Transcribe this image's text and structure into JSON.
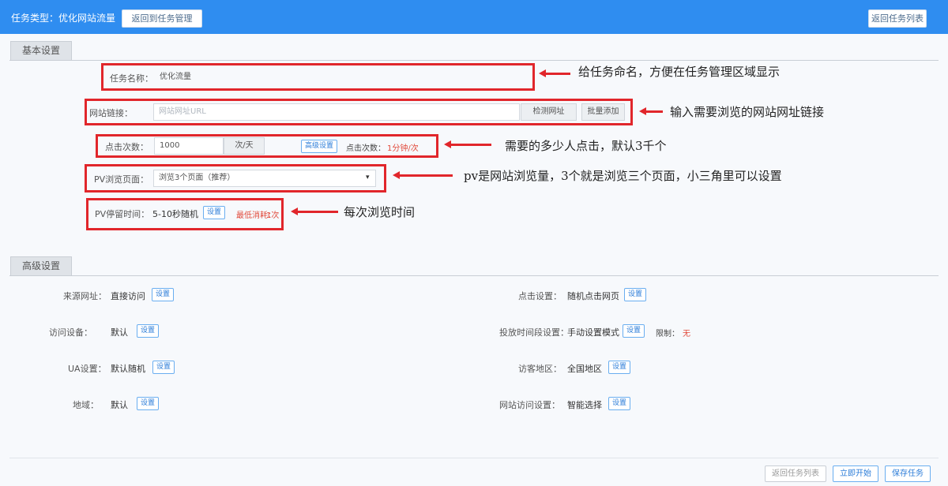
{
  "header": {
    "title": "任务类型：优化网站流量",
    "center_button": "返回到任务管理",
    "right_button": "返回任务列表"
  },
  "basic_section": {
    "title": "基本设置"
  },
  "form": {
    "task_name": {
      "label": "任务名称：",
      "value": "优化流量"
    },
    "url": {
      "label": "网站链接：",
      "placeholder": "网站网址URL",
      "button1": "检测网址",
      "button2": "批量添加"
    },
    "clicks": {
      "label": "点击次数：",
      "value": "1000",
      "unit": "次/天",
      "link_button": "高级设置",
      "extra_label": "点击次数：",
      "extra_value": "1分钟/次"
    },
    "pv": {
      "label": "PV浏览页面：",
      "value": "浏览3个页面（推荐）",
      "caret": "▾"
    },
    "pv_time": {
      "label": "PV停留时间：",
      "value": "5-10秒随机",
      "button": "设置",
      "red_text": "最低消耗：",
      "red_value": "1次"
    }
  },
  "annotations": {
    "n1": "给任务命名，方便在任务管理区域显示",
    "n2": "输入需要浏览的网站网址链接",
    "n3": "需要的多少人点击，默认3千个",
    "n4": "pv是网站浏览量，3个就是浏览三个页面，小三角里可以设置",
    "n5": "每次浏览时间"
  },
  "advanced_section": {
    "title": "高级设置"
  },
  "advanced": {
    "left": [
      {
        "label": "来源网址：",
        "value": "直接访问",
        "button": "设置"
      },
      {
        "label": "访问设备：",
        "value": "默认",
        "button": "设置"
      },
      {
        "label": "UA设置：",
        "value": "默认随机",
        "button": "设置"
      },
      {
        "label": "地域：",
        "value": "默认",
        "button": "设置"
      }
    ],
    "right": [
      {
        "label": "点击设置：",
        "value": "随机点击网页",
        "button": "设置"
      },
      {
        "label": "投放时间段设置：",
        "value": "手动设置模式",
        "button": "设置",
        "extra": "限制：",
        "extra_red": "无"
      },
      {
        "label": "访客地区：",
        "value": "全国地区",
        "button": "设置"
      },
      {
        "label": "网站访问设置：",
        "value": "智能选择",
        "button": "设置"
      }
    ]
  },
  "footer": {
    "b1": "返回任务列表",
    "b2": "立即开始",
    "b3": "保存任务"
  }
}
